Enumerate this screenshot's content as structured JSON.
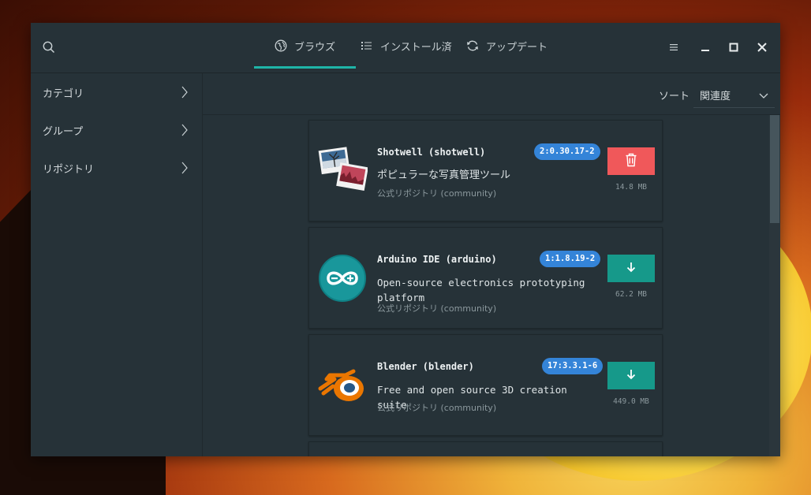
{
  "header": {
    "tabs": [
      {
        "label": "ブラウズ",
        "icon": "globe-icon",
        "active": true
      },
      {
        "label": "インストール済",
        "icon": "list-icon",
        "active": false
      },
      {
        "label": "アップデート",
        "icon": "refresh-icon",
        "active": false
      }
    ],
    "controls": {
      "menu": "hamburger-menu-icon",
      "minimize": "minimize-icon",
      "maximize": "maximize-icon",
      "close": "close-icon"
    }
  },
  "sidebar": {
    "items": [
      {
        "label": "カテゴリ"
      },
      {
        "label": "グループ"
      },
      {
        "label": "リポジトリ"
      }
    ]
  },
  "sort": {
    "label": "ソート",
    "value": "関連度"
  },
  "packages": [
    {
      "name": "Shotwell (shotwell)",
      "version": "2:0.30.17-2",
      "description": "ポピュラーな写真管理ツール",
      "repo": "公式リポジトリ (community)",
      "action": "remove",
      "size": "14.8 MB"
    },
    {
      "name": "Arduino IDE (arduino)",
      "version": "1:1.8.19-2",
      "description": "Open-source electronics prototyping platform",
      "repo": "公式リポジトリ (community)",
      "action": "install",
      "size": "62.2 MB"
    },
    {
      "name": "Blender (blender)",
      "version": "17:3.3.1-6",
      "description": "Free and open source 3D creation suite",
      "repo": "公式リポジトリ (community)",
      "action": "install",
      "size": "449.0 MB"
    }
  ],
  "colors": {
    "accent": "#1fb5a8",
    "install": "#16998a",
    "remove": "#f0585a",
    "version_badge": "#3484d8",
    "window_bg": "#263238"
  }
}
